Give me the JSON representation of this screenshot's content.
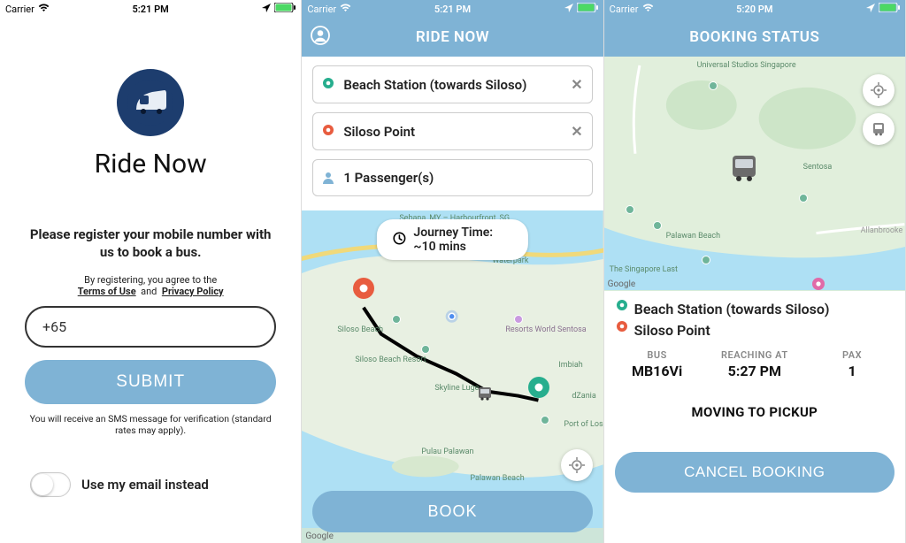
{
  "status_bar": {
    "carrier": "Carrier",
    "time1": "5:21 PM",
    "time2": "5:21 PM",
    "time3": "5:20 PM"
  },
  "screen1": {
    "title": "Ride Now",
    "register_prompt": "Please register your mobile number with us to book a bus.",
    "agree_prefix": "By registering, you agree to the",
    "terms_label": "Terms of Use",
    "and": "and",
    "privacy_label": "Privacy Policy",
    "phone_value": "+65",
    "submit_label": "SUBMIT",
    "sms_note": "You will receive an SMS message for verification (standard rates may apply).",
    "email_toggle_label": "Use my email instead"
  },
  "screen2": {
    "header": "RIDE NOW",
    "origin": "Beach Station (towards Siloso)",
    "destination": "Siloso Point",
    "passengers": "1 Passenger(s)",
    "journey_time": "Journey Time: ~10 mins",
    "book_label": "BOOK",
    "map_attr": "Google",
    "map_labels": {
      "sebana": "Sebana, MY – Harbourfront, SG",
      "waterpark": "Waterpark",
      "silosobeach": "Siloso Beach",
      "silosoresort": "Siloso Beach Resort",
      "skyline": "Skyline Luge",
      "resortsworld": "Resorts World Sentosa",
      "imbiah": "Imbiah",
      "pulau": "Pulau Palawan",
      "palawan": "Palawan Beach",
      "portoflos": "Port of Los",
      "dzania": "dZania"
    }
  },
  "screen3": {
    "header": "BOOKING STATUS",
    "origin": "Beach Station (towards Siloso)",
    "destination": "Siloso Point",
    "bus_label": "BUS",
    "bus_value": "MB16Vi",
    "reaching_label": "REACHING AT",
    "reaching_value": "5:27 PM",
    "pax_label": "PAX",
    "pax_value": "1",
    "status_text": "MOVING TO PICKUP",
    "cancel_label": "CANCEL BOOKING",
    "map_attr": "Google",
    "map_labels": {
      "universal": "Universal Studios Singapore",
      "sentosa": "Sentosa",
      "palawan": "Palawan Beach",
      "singlast": "The Singapore Last",
      "allanbrooke": "Allanbrooke"
    }
  }
}
